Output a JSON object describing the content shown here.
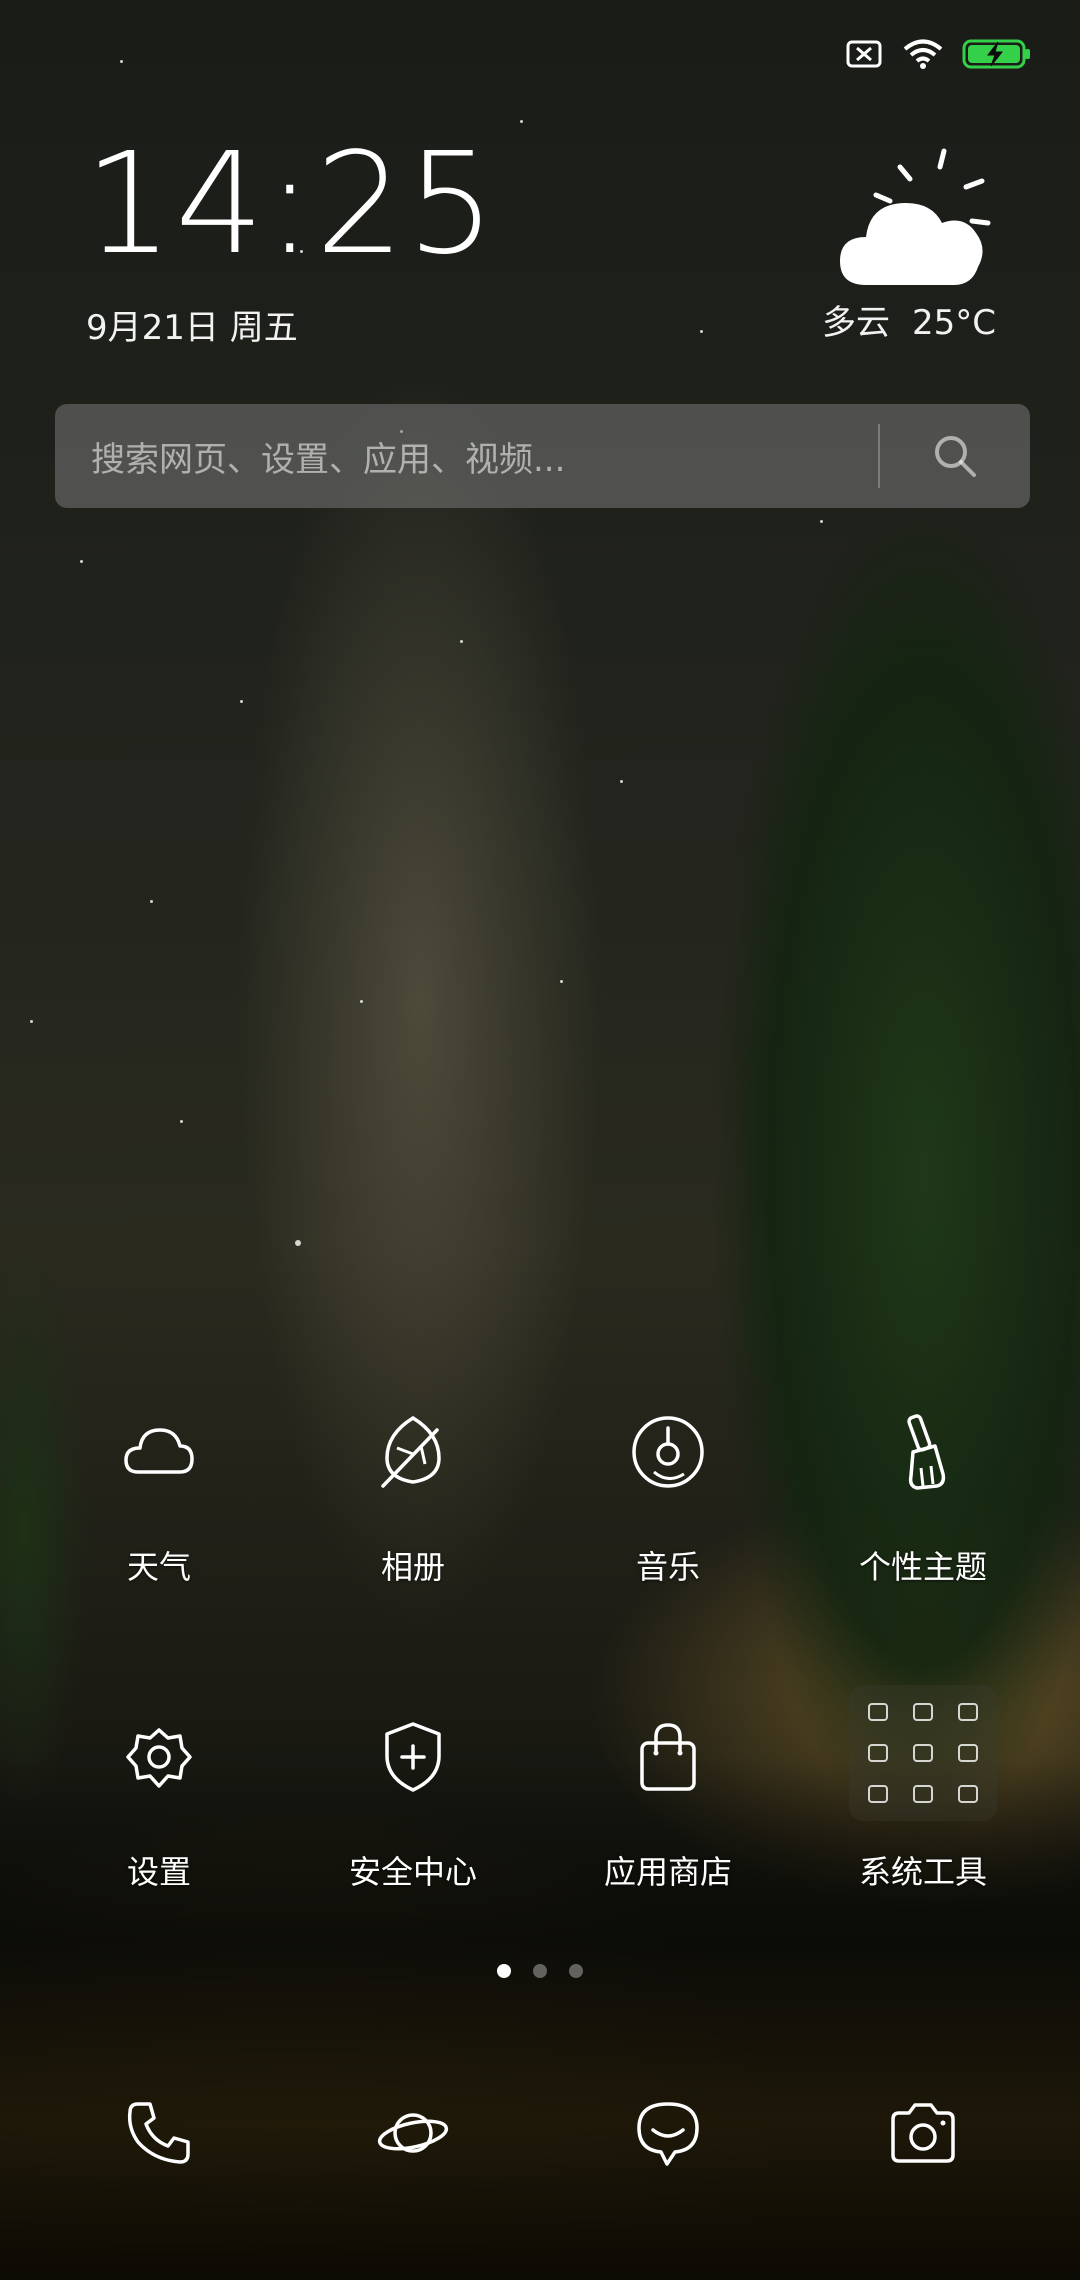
{
  "status_bar": {
    "icons": [
      "sim-off-icon",
      "wifi-icon",
      "battery-charging-icon"
    ]
  },
  "clock": {
    "time": "14:25",
    "date": "9月21日 周五"
  },
  "weather": {
    "icon": "partly-cloudy-icon",
    "condition": "多云",
    "temperature": "25°C"
  },
  "search": {
    "placeholder": "搜索网页、设置、应用、视频..."
  },
  "apps": [
    {
      "label": "天气",
      "icon": "weather-cloud-icon"
    },
    {
      "label": "相册",
      "icon": "gallery-leaf-icon"
    },
    {
      "label": "音乐",
      "icon": "music-disc-icon"
    },
    {
      "label": "个性主题",
      "icon": "themes-brush-icon"
    },
    {
      "label": "设置",
      "icon": "settings-gear-icon"
    },
    {
      "label": "安全中心",
      "icon": "security-shield-icon"
    },
    {
      "label": "应用商店",
      "icon": "app-store-bag-icon"
    },
    {
      "label": "系统工具",
      "icon": "folder-icon"
    }
  ],
  "page_indicator": {
    "pages": 3,
    "current": 1
  },
  "dock": [
    {
      "icon": "phone-icon"
    },
    {
      "icon": "browser-planet-icon"
    },
    {
      "icon": "messages-icon"
    },
    {
      "icon": "camera-icon"
    }
  ],
  "colors": {
    "text": "#ffffff",
    "battery": "#35d04a"
  }
}
